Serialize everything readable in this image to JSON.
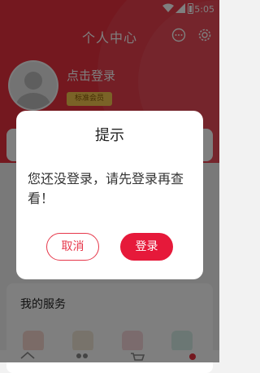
{
  "status_bar": {
    "time": "5:05"
  },
  "header": {
    "title": "个人中心",
    "login_text": "点击登录",
    "member_badge": "标准会员"
  },
  "services": {
    "title": "我的服务"
  },
  "dialog": {
    "title": "提示",
    "message": "您还没登录，请先登录再查看！",
    "cancel_label": "取消",
    "login_label": "登录"
  },
  "colors": {
    "brand": "#e8303f",
    "button_primary": "#e6193a",
    "badge": "#f4c64e"
  }
}
